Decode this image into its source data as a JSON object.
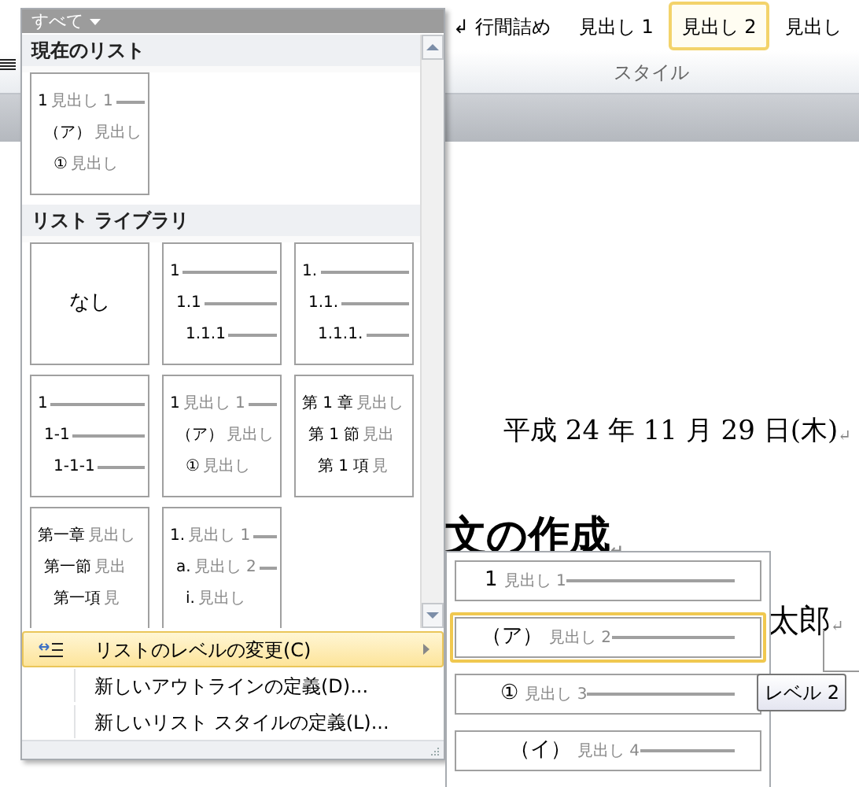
{
  "ribbon": {
    "styles": [
      {
        "label": "↲ 行間詰め",
        "selected": false
      },
      {
        "label": "見出し 1",
        "selected": false
      },
      {
        "label": "見出し 2",
        "selected": true
      },
      {
        "label": "見出し",
        "selected": false
      }
    ],
    "group_label": "スタイル"
  },
  "document": {
    "lines": [
      {
        "kind": "date",
        "text": "平成 24 年 11 月 29 日(木)",
        "mark": "↵"
      },
      {
        "kind": "heading",
        "text": "文の作成",
        "mark": "↵"
      },
      {
        "kind": "author",
        "text": "太郎",
        "mark": "↵"
      }
    ]
  },
  "list_menu": {
    "filter": "すべて",
    "sections": [
      {
        "title": "現在のリスト",
        "thumbnails": [
          {
            "kind": "list",
            "lines": [
              {
                "number": "1",
                "label": "見出し 1",
                "rule": true
              },
              {
                "number": "（ア）",
                "label": "見出し",
                "rule": false
              },
              {
                "number": "①",
                "label": "見出し",
                "rule": false
              }
            ]
          }
        ]
      },
      {
        "title": "リスト ライブラリ",
        "thumbnails": [
          {
            "kind": "none",
            "label": "なし"
          },
          {
            "kind": "list",
            "lines": [
              {
                "number": "1",
                "rule": true
              },
              {
                "number": "1.1",
                "rule": true
              },
              {
                "number": "1.1.1",
                "rule": true
              }
            ]
          },
          {
            "kind": "list",
            "lines": [
              {
                "number": "1.",
                "rule": true
              },
              {
                "number": "1.1.",
                "rule": true
              },
              {
                "number": "1.1.1.",
                "rule": true
              }
            ]
          },
          {
            "kind": "list",
            "lines": [
              {
                "number": "1",
                "rule": true
              },
              {
                "number": "1-1",
                "rule": true
              },
              {
                "number": "1-1-1",
                "rule": true
              }
            ]
          },
          {
            "kind": "list",
            "lines": [
              {
                "number": "1",
                "label": "見出し 1",
                "rule": true
              },
              {
                "number": "（ア）",
                "label": "見出し",
                "rule": false
              },
              {
                "number": "①",
                "label": "見出し",
                "rule": false
              }
            ]
          },
          {
            "kind": "list",
            "lines": [
              {
                "number": "第 1 章",
                "label": "見出し",
                "rule": false
              },
              {
                "number": "第 1 節",
                "label": "見出",
                "rule": false
              },
              {
                "number": "第 1 項",
                "label": "見",
                "rule": false
              }
            ]
          },
          {
            "kind": "list",
            "lines": [
              {
                "number": "第一章",
                "label": "見出し",
                "rule": false
              },
              {
                "number": "第一節",
                "label": "見出",
                "rule": false
              },
              {
                "number": "第一項",
                "label": "見",
                "rule": false
              }
            ]
          },
          {
            "kind": "list",
            "lines": [
              {
                "number": "1.",
                "label": "見出し 1",
                "rule": true
              },
              {
                "number": "a.",
                "label": "見出し 2",
                "rule": true
              },
              {
                "number": "i.",
                "label": "見出し",
                "rule": false
              }
            ]
          }
        ]
      }
    ],
    "items": [
      {
        "kind": "submenu",
        "label": "リストのレベルの変更(C)",
        "highlighted": true
      },
      {
        "kind": "action",
        "label": "新しいアウトラインの定義(D)...",
        "highlighted": false
      },
      {
        "kind": "action",
        "label": "新しいリスト スタイルの定義(L)...",
        "highlighted": false
      }
    ]
  },
  "level_submenu": {
    "items": [
      {
        "number": "1",
        "label": "見出し 1",
        "selected": false
      },
      {
        "number": "（ア）",
        "label": "見出し 2",
        "selected": true
      },
      {
        "number": "①",
        "label": "見出し 3",
        "selected": false
      },
      {
        "number": "（イ）",
        "label": "見出し 4",
        "selected": false
      }
    ]
  },
  "tooltip": "レベル 2"
}
